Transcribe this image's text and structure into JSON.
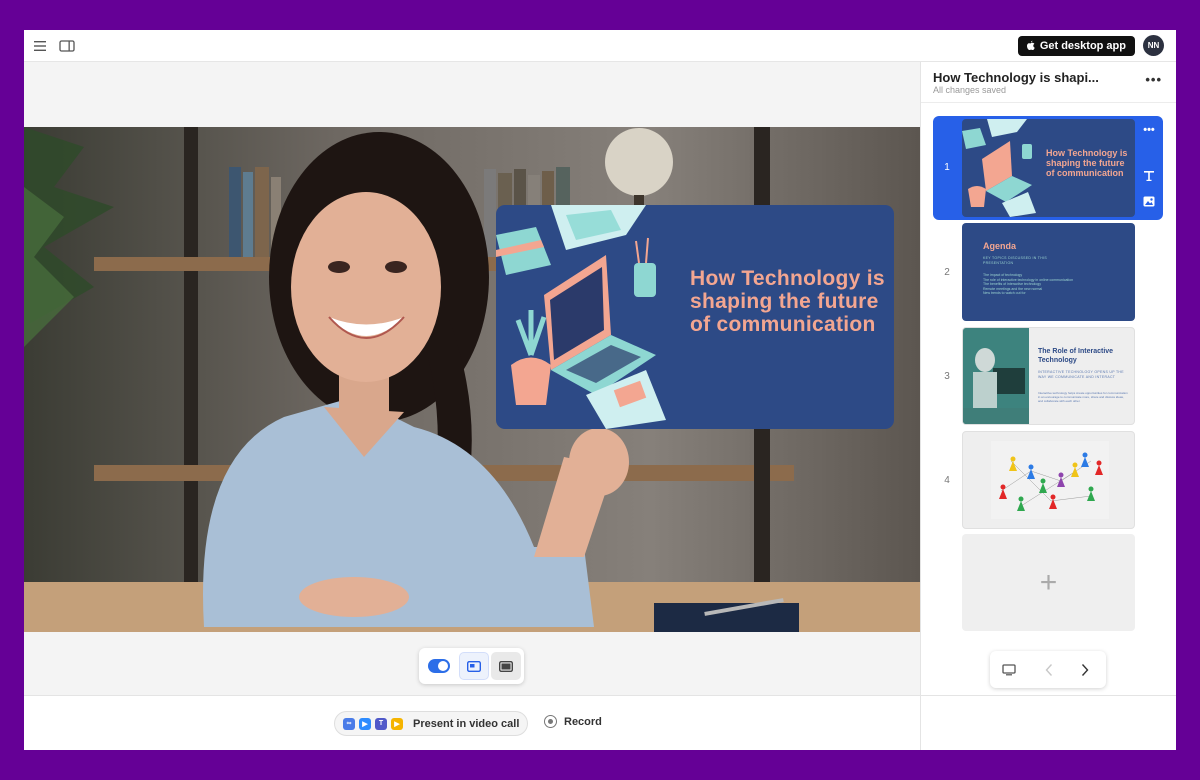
{
  "topbar": {
    "menu_icon": "hamburger-icon",
    "panel_icon": "sidebar-panel-icon",
    "desktop_button": "Get desktop app",
    "avatar_initials": "NN"
  },
  "stage": {
    "slide_overlay_title": "How Technology is shaping the future of communication"
  },
  "bottombar": {
    "present_label": "Present in video call",
    "record_label": "Record"
  },
  "sidebar": {
    "doc_title": "How Technology is shapi...",
    "doc_status": "All changes saved",
    "menu": "•••",
    "slides": [
      {
        "number": "1",
        "title": "How Technology is shaping the future of communication"
      },
      {
        "number": "2",
        "title": "Agenda",
        "subtitle": "KEY TOPICS DISCUSSED IN THIS PRESENTATION",
        "bullets": [
          "The impact of technology",
          "The role of interactive technology in online communication",
          "The benefits of interactive technology",
          "Remote meetings and the new normal",
          "New trends to watch out for"
        ]
      },
      {
        "number": "3",
        "title": "The Role of Interactive Technology",
        "subtitle": "INTERACTIVE TECHNOLOGY OPENS UP THE WAY WE COMMUNICATE AND INTERACT",
        "body": "Interactive technology helps create opportunities for communication in an encourage to communicate more, share and discuss ideas, and collaborate with each other."
      },
      {
        "number": "4"
      }
    ],
    "add_label": "+"
  },
  "colors": {
    "background": "#650096",
    "accent": "#2760e8",
    "slide_bg": "#2d4a86",
    "slide_title": "#f3a691"
  }
}
